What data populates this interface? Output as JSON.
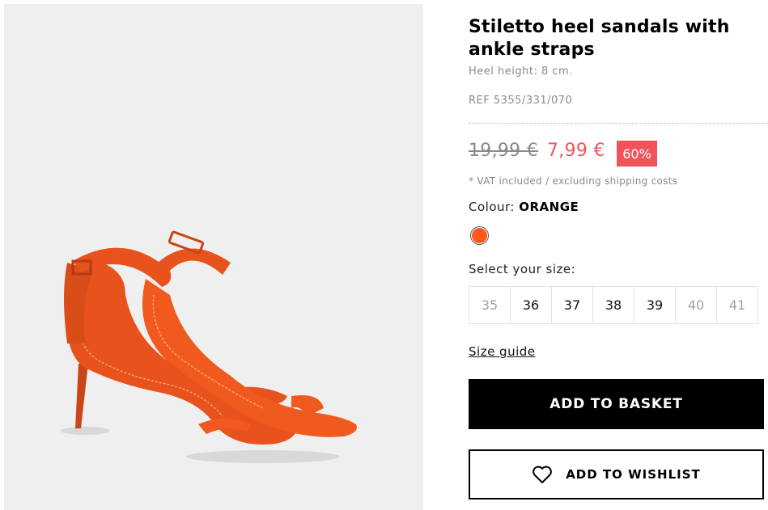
{
  "product": {
    "title": "Stiletto heel sandals with ankle straps",
    "heel_height": "Heel height: 8 cm.",
    "ref": "REF 5355/331/070",
    "old_price": "19,99 €",
    "new_price": "7,99 €",
    "discount": "60%",
    "vat_note": "* VAT included / excluding shipping costs"
  },
  "colour": {
    "label": "Colour:",
    "value": "ORANGE",
    "swatch_color": "#ff5a1a"
  },
  "sizes": {
    "label": "Select your size:",
    "options": [
      {
        "size": "35",
        "available": false
      },
      {
        "size": "36",
        "available": true
      },
      {
        "size": "37",
        "available": true
      },
      {
        "size": "38",
        "available": true
      },
      {
        "size": "39",
        "available": true
      },
      {
        "size": "40",
        "available": false
      },
      {
        "size": "41",
        "available": false
      }
    ]
  },
  "links": {
    "size_guide": "Size guide"
  },
  "actions": {
    "add_to_basket": "ADD TO BASKET",
    "add_to_wishlist": "ADD TO WISHLIST",
    "wishlist_icon": "heart-icon"
  },
  "colors": {
    "sale": "#f0545a",
    "shoe": "#f05a1e"
  }
}
